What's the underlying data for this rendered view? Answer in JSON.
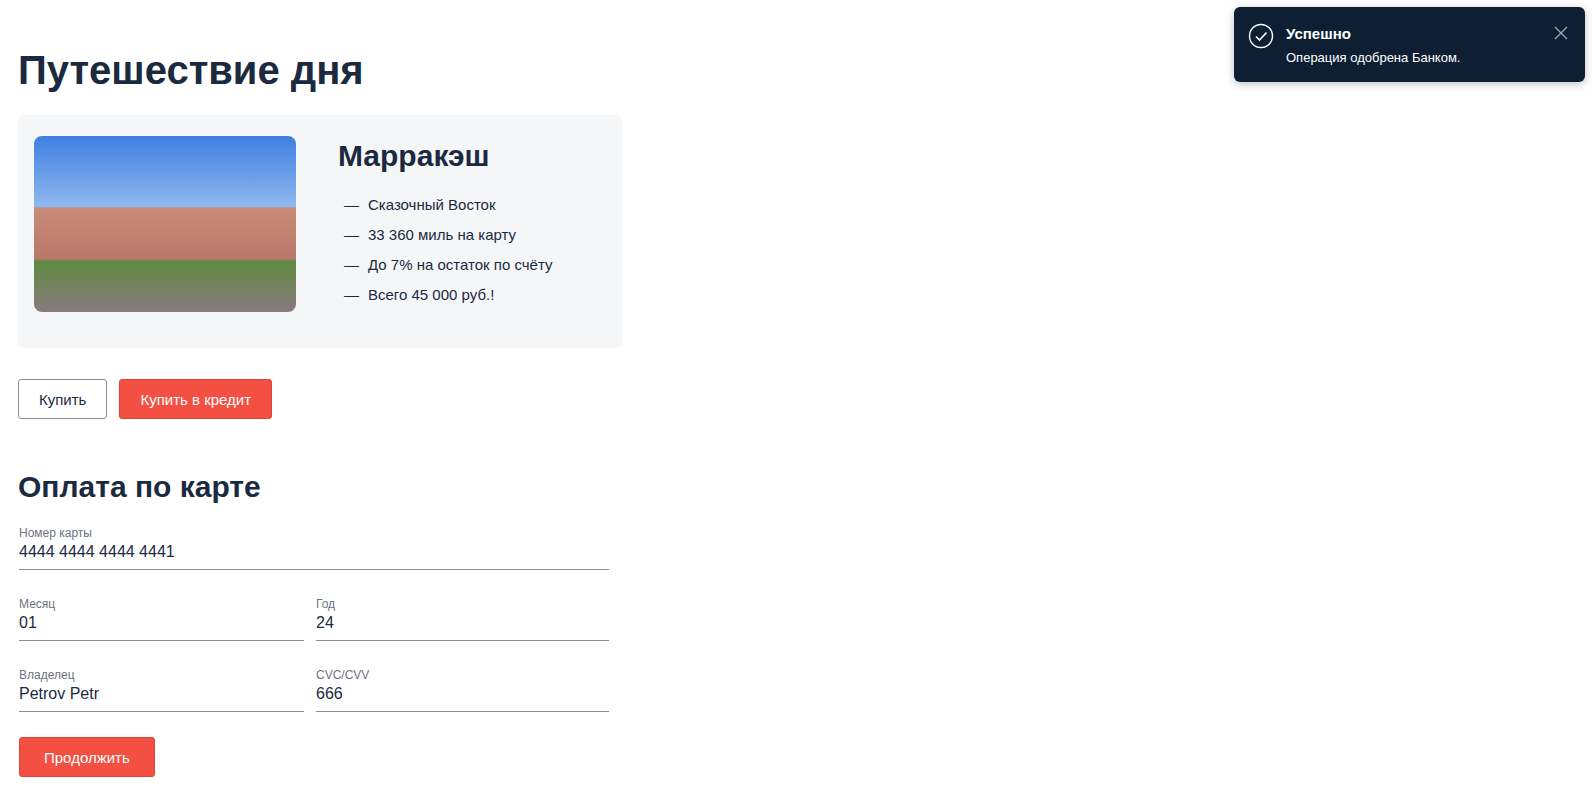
{
  "page": {
    "title": "Путешествие дня"
  },
  "offer": {
    "city": "Марракэш",
    "features": [
      {
        "dash": "—",
        "text": "Сказочный Восток"
      },
      {
        "dash": "—",
        "text": "33 360 миль на карту"
      },
      {
        "dash": "—",
        "text": "До 7% на остаток по счёту"
      },
      {
        "dash": "—",
        "text": "Всего 45 000 руб.!"
      }
    ]
  },
  "buttons": [
    {
      "label": "Купить",
      "kind": "outline"
    },
    {
      "label": "Купить в кредит",
      "kind": "primary"
    }
  ],
  "payment": {
    "title": "Оплата по карте",
    "rows": [
      [
        {
          "label": "Номер карты",
          "value": "4444 4444 4444 4441"
        }
      ],
      [
        {
          "label": "Месяц",
          "value": "01"
        },
        {
          "label": "Год",
          "value": "24"
        }
      ],
      [
        {
          "label": "Владелец",
          "value": "Petrov Petr"
        },
        {
          "label": "CVC/CVV",
          "value": "666"
        }
      ]
    ],
    "submit": "Продолжить"
  },
  "notification": {
    "title": "Успешно",
    "message": "Операция одобрена Банком."
  }
}
